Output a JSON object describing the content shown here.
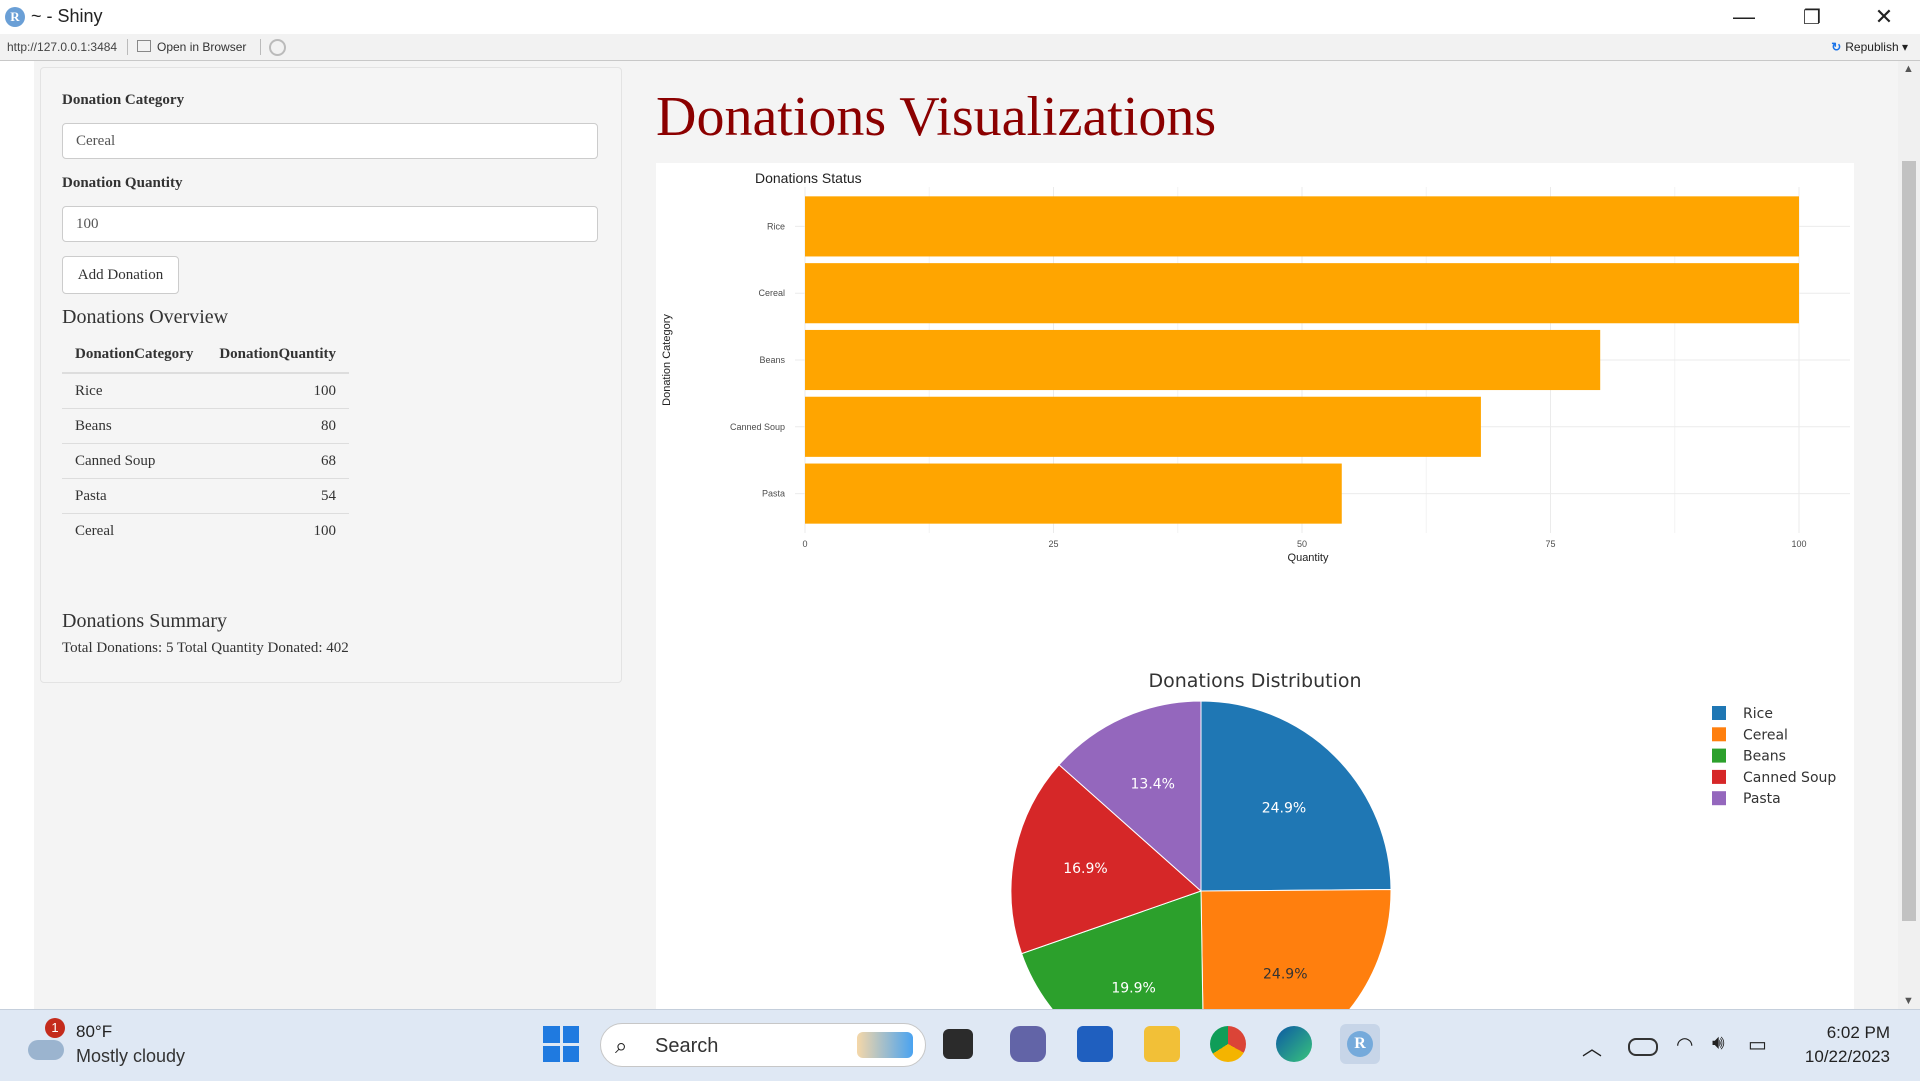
{
  "window": {
    "title": "~ - Shiny",
    "logo": "R",
    "minimize_icon": "—",
    "restore_icon": "❐",
    "close_icon": "✕"
  },
  "addressbar": {
    "url": "http://127.0.0.1:3484",
    "open_in_browser": "Open in Browser",
    "republish": "Republish",
    "republish_icon": "↻",
    "dropdown_icon": "▾"
  },
  "sidebar": {
    "category_label": "Donation Category",
    "category_value": "Cereal",
    "quantity_label": "Donation Quantity",
    "quantity_value": "100",
    "add_button": "Add Donation",
    "overview_title": "Donations Overview",
    "table_headers": [
      "DonationCategory",
      "DonationQuantity"
    ],
    "table_rows": [
      {
        "category": "Rice",
        "quantity": "100"
      },
      {
        "category": "Beans",
        "quantity": "80"
      },
      {
        "category": "Canned Soup",
        "quantity": "68"
      },
      {
        "category": "Pasta",
        "quantity": "54"
      },
      {
        "category": "Cereal",
        "quantity": "100"
      }
    ],
    "summary_title": "Donations Summary",
    "summary_text": "Total Donations: 5 Total Quantity Donated: 402"
  },
  "main": {
    "title": "Donations Visualizations"
  },
  "chart_data": [
    {
      "type": "bar",
      "orientation": "horizontal",
      "title": "Donations Status",
      "xlabel": "Quantity",
      "ylabel": "Donation Category",
      "categories": [
        "Rice",
        "Cereal",
        "Beans",
        "Canned Soup",
        "Pasta"
      ],
      "values": [
        100,
        100,
        80,
        68,
        54
      ],
      "xlim": [
        0,
        100
      ],
      "xticks": [
        0,
        25,
        50,
        75,
        100
      ],
      "bar_color": "#ffa500",
      "grid": true
    },
    {
      "type": "pie",
      "title": "Donations Distribution",
      "labels": [
        "Rice",
        "Cereal",
        "Beans",
        "Canned Soup",
        "Pasta"
      ],
      "values": [
        100,
        100,
        80,
        68,
        54
      ],
      "percent_labels": [
        "24.9%",
        "24.9%",
        "19.9%",
        "16.9%",
        "13.4%"
      ],
      "colors": [
        "#1f77b4",
        "#ff7f0e",
        "#2ca02c",
        "#d62728",
        "#9467bd"
      ],
      "legend": "right"
    }
  ],
  "taskbar": {
    "weather_badge": "1",
    "temperature": "80°F",
    "weather": "Mostly cloudy",
    "search_placeholder": "Search",
    "search_icon": "⌕",
    "time": "6:02 PM",
    "date": "10/22/2023",
    "tray_chevron": "︿",
    "wifi_icon": "◠",
    "volume_icon": "🔊︎",
    "battery_icon": "▭"
  }
}
